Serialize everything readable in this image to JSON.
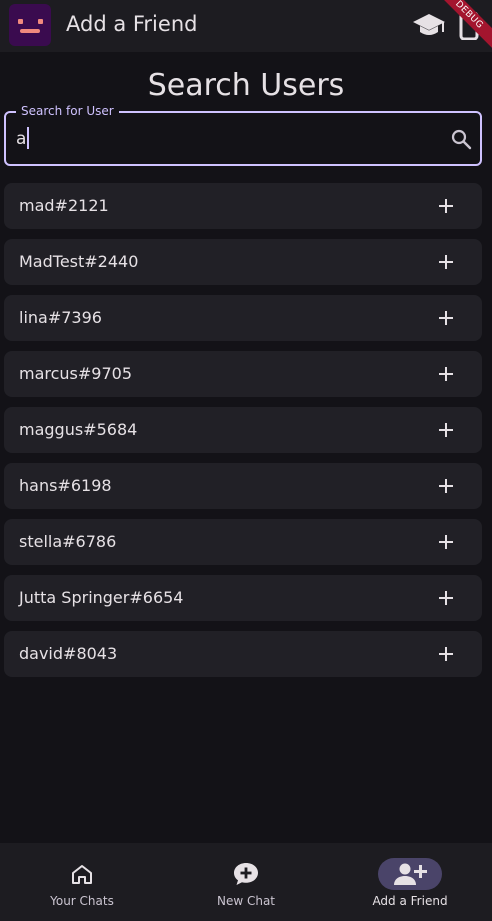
{
  "appbar": {
    "title": "Add a Friend",
    "debug_banner": "DEBUG"
  },
  "page": {
    "heading": "Search Users"
  },
  "search": {
    "label": "Search for User",
    "value": "a"
  },
  "results": [
    {
      "name": "mad#2121"
    },
    {
      "name": "MadTest#2440"
    },
    {
      "name": "lina#7396"
    },
    {
      "name": "marcus#9705"
    },
    {
      "name": "maggus#5684"
    },
    {
      "name": "hans#6198"
    },
    {
      "name": "stella#6786"
    },
    {
      "name": "Jutta Springer#6654"
    },
    {
      "name": "david#8043"
    }
  ],
  "bottom_nav": {
    "items": [
      {
        "label": "Your Chats",
        "icon": "home-icon"
      },
      {
        "label": "New Chat",
        "icon": "chat-add-icon"
      },
      {
        "label": "Add a Friend",
        "icon": "person-add-icon",
        "active": true
      }
    ]
  },
  "colors": {
    "accent": "#cfc2ff",
    "active_pill": "#4a4469",
    "background": "#131217",
    "surface": "#212026"
  }
}
